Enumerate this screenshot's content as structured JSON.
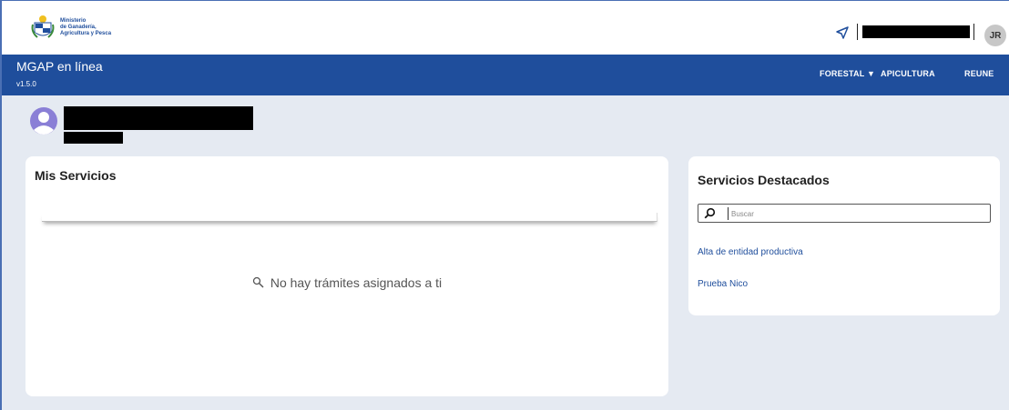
{
  "header": {
    "logo_lines": [
      "Ministerio",
      "de Ganadería,",
      "Agricultura y Pesca"
    ],
    "user_initials": "JR"
  },
  "nav": {
    "app_title": "MGAP en línea",
    "version": "v1.5.0",
    "items": [
      {
        "label": "FORESTAL ▼"
      },
      {
        "label": "APICULTURA"
      },
      {
        "label": "REUNE"
      }
    ]
  },
  "mis_servicios": {
    "title": "Mis Servicios",
    "empty_message": "No hay trámites asignados a ti"
  },
  "servicios_destacados": {
    "title": "Servicios Destacados",
    "search_placeholder": "Buscar",
    "links": [
      {
        "label": "Alta de entidad productiva"
      },
      {
        "label": "Prueba Nico"
      }
    ]
  },
  "colors": {
    "brand_blue": "#1f4e9c",
    "background": "#e5eaf2",
    "avatar_purple": "#8a7fd6"
  }
}
